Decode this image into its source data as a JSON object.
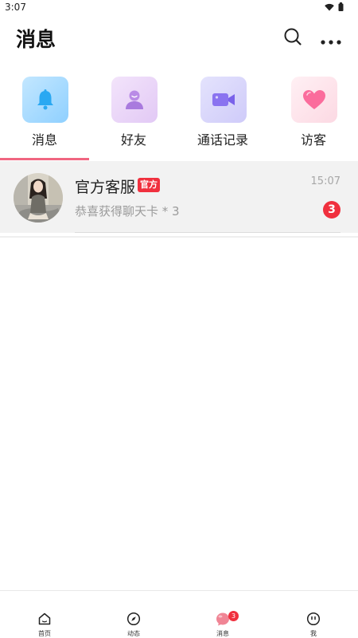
{
  "status_bar": {
    "time": "3:07",
    "icons": [
      "wifi-icon",
      "battery-icon"
    ]
  },
  "header": {
    "title": "消息",
    "actions": [
      "search-icon",
      "more-icon"
    ]
  },
  "tabs": [
    {
      "label": "消息",
      "icon": "bell-icon",
      "active": true
    },
    {
      "label": "好友",
      "icon": "person-icon",
      "active": false
    },
    {
      "label": "通话记录",
      "icon": "video-camera-icon",
      "active": false
    },
    {
      "label": "访客",
      "icon": "heart-icon",
      "active": false
    }
  ],
  "colors": {
    "accent": "#f06680",
    "badge_red": "#f0303e",
    "tab_bell_bg": "#a8dcff",
    "tab_friend_bg": "#e9d5f7",
    "tab_video_bg": "#d8d6fb",
    "tab_heart_bg": "#fde2ea",
    "selected_row_bg": "#f2f2f2"
  },
  "conversations": [
    {
      "name": "官方客服",
      "badge": "官方",
      "time": "15:07",
      "preview": "恭喜获得聊天卡 * 3",
      "unread": "3"
    }
  ],
  "bottom_nav": {
    "items": [
      {
        "label": "首页",
        "icon": "home-icon"
      },
      {
        "label": "动态",
        "icon": "compass-icon"
      },
      {
        "label": "消息",
        "icon": "message-bubble-icon",
        "badge": "3",
        "active": true
      },
      {
        "label": "我",
        "icon": "profile-face-icon"
      }
    ]
  }
}
